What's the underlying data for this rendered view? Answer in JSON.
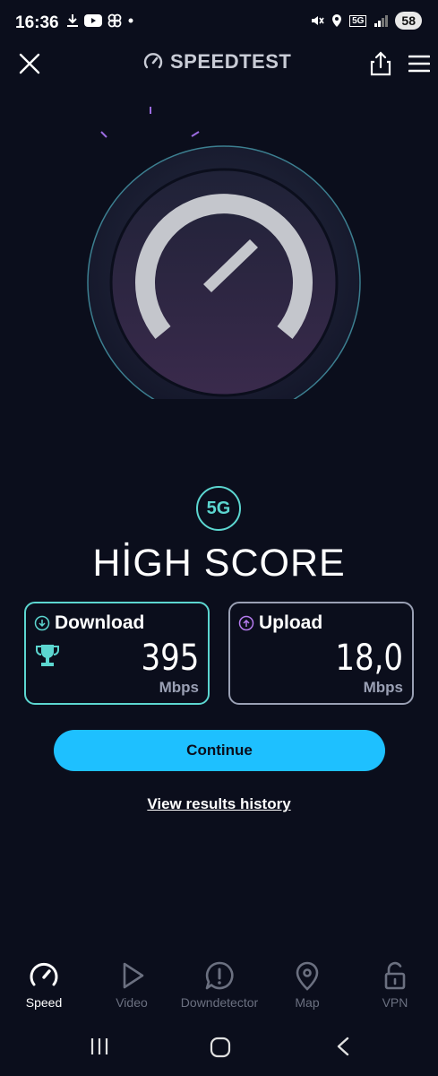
{
  "status": {
    "time": "16:36",
    "network": "5G",
    "battery": "58"
  },
  "header": {
    "brand": "SPEEDTEST"
  },
  "result": {
    "network_badge": "5G",
    "score_title": "HİGH SCORE",
    "download": {
      "label": "Download",
      "value": "395",
      "unit": "Mbps"
    },
    "upload": {
      "label": "Upload",
      "value": "18,0",
      "unit": "Mbps"
    }
  },
  "actions": {
    "continue_label": "Continue",
    "history_label": "View results history"
  },
  "nav": {
    "items": [
      {
        "label": "Speed",
        "icon": "speed-icon",
        "active": true
      },
      {
        "label": "Video",
        "icon": "play-icon",
        "active": false
      },
      {
        "label": "Downdetector",
        "icon": "alert-icon",
        "active": false
      },
      {
        "label": "Map",
        "icon": "map-pin-icon",
        "active": false
      },
      {
        "label": "VPN",
        "icon": "lock-icon",
        "active": false
      }
    ]
  },
  "colors": {
    "background": "#0b0e1c",
    "accent_teal": "#5cd6d0",
    "accent_purple": "#b57bee",
    "button_blue": "#1ec0ff"
  }
}
